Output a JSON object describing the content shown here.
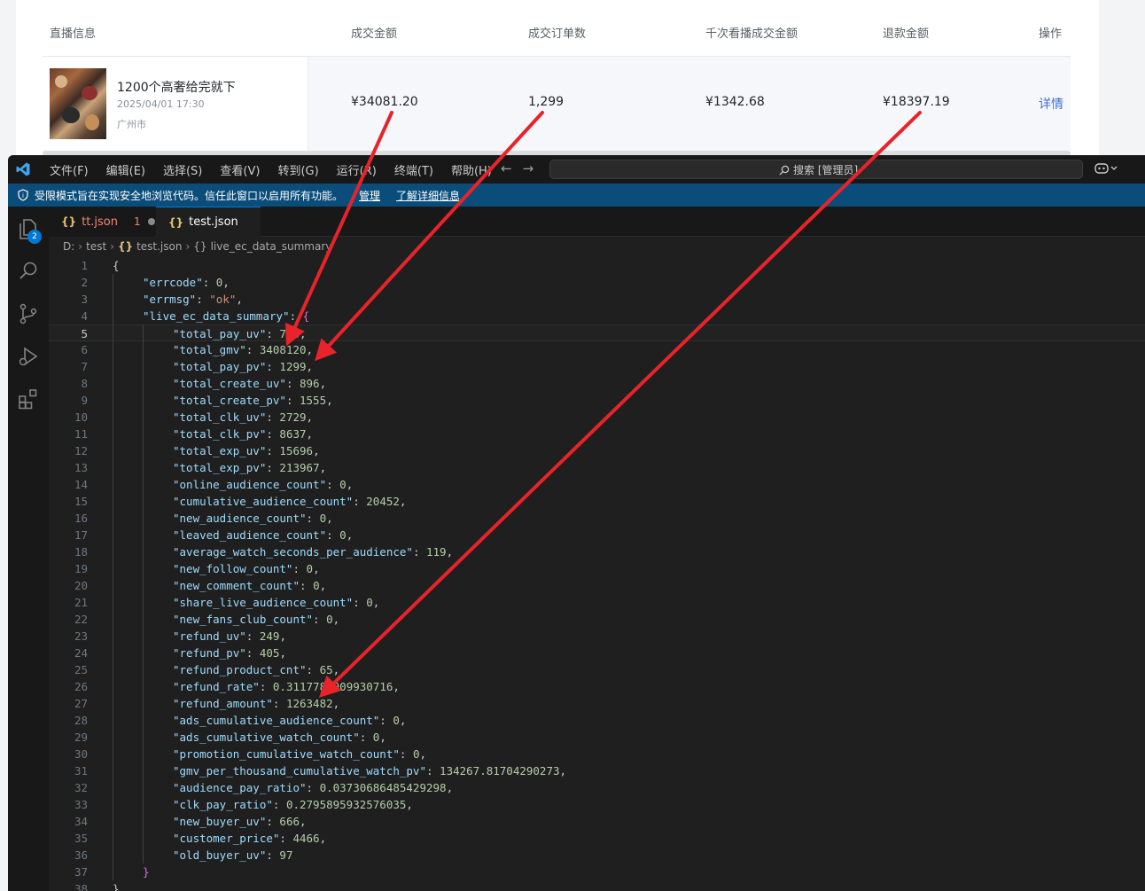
{
  "web_table": {
    "headers": [
      "直播信息",
      "成交金额",
      "成交订单数",
      "千次看播成交金额",
      "退款金额",
      "操作"
    ],
    "row": {
      "title": "1200个高奢给完就下",
      "time": "2025/04/01 17:30",
      "city": "广州市",
      "gmv": "¥34081.20",
      "orders": "1,299",
      "gmv_per_thousand": "¥1342.68",
      "refund": "¥18397.19",
      "action": "详情"
    }
  },
  "vscode": {
    "menu": [
      "文件(F)",
      "编辑(E)",
      "选择(S)",
      "查看(V)",
      "转到(G)",
      "运行(R)",
      "终端(T)",
      "帮助(H)"
    ],
    "search_placeholder": "搜索 [管理员]",
    "banner": {
      "text": "受限模式旨在实现安全地浏览代码。信任此窗口以启用所有功能。",
      "manage": "管理",
      "learn_more": "了解详细信息"
    },
    "explorer_badge": "2",
    "tabs": [
      {
        "name": "tt.json",
        "problems": "1",
        "modified": true,
        "active": false
      },
      {
        "name": "test.json",
        "modified": true,
        "active": true
      }
    ],
    "breadcrumb": [
      "D:",
      "test",
      "test.json",
      "live_ec_data_summary"
    ],
    "current_line": 5,
    "code_lines": [
      [
        [
          "p",
          "{"
        ]
      ],
      [
        [
          "k",
          "\"errcode\""
        ],
        [
          "p",
          ": "
        ],
        [
          "n",
          "0"
        ],
        [
          "p",
          ","
        ]
      ],
      [
        [
          "k",
          "\"errmsg\""
        ],
        [
          "p",
          ": "
        ],
        [
          "s",
          "\"ok\""
        ],
        [
          "p",
          ","
        ]
      ],
      [
        [
          "k",
          "\"live_ec_data_summary\""
        ],
        [
          "p",
          ": "
        ],
        [
          "b2",
          "{"
        ]
      ],
      [
        [
          "k",
          "\"total_pay_uv\""
        ],
        [
          "p",
          ": "
        ],
        [
          "n",
          "763"
        ],
        [
          "p",
          ","
        ]
      ],
      [
        [
          "k",
          "\"total_gmv\""
        ],
        [
          "p",
          ": "
        ],
        [
          "n",
          "3408120"
        ],
        [
          "p",
          ","
        ]
      ],
      [
        [
          "k",
          "\"total_pay_pv\""
        ],
        [
          "p",
          ": "
        ],
        [
          "n",
          "1299"
        ],
        [
          "p",
          ","
        ]
      ],
      [
        [
          "k",
          "\"total_create_uv\""
        ],
        [
          "p",
          ": "
        ],
        [
          "n",
          "896"
        ],
        [
          "p",
          ","
        ]
      ],
      [
        [
          "k",
          "\"total_create_pv\""
        ],
        [
          "p",
          ": "
        ],
        [
          "n",
          "1555"
        ],
        [
          "p",
          ","
        ]
      ],
      [
        [
          "k",
          "\"total_clk_uv\""
        ],
        [
          "p",
          ": "
        ],
        [
          "n",
          "2729"
        ],
        [
          "p",
          ","
        ]
      ],
      [
        [
          "k",
          "\"total_clk_pv\""
        ],
        [
          "p",
          ": "
        ],
        [
          "n",
          "8637"
        ],
        [
          "p",
          ","
        ]
      ],
      [
        [
          "k",
          "\"total_exp_uv\""
        ],
        [
          "p",
          ": "
        ],
        [
          "n",
          "15696"
        ],
        [
          "p",
          ","
        ]
      ],
      [
        [
          "k",
          "\"total_exp_pv\""
        ],
        [
          "p",
          ": "
        ],
        [
          "n",
          "213967"
        ],
        [
          "p",
          ","
        ]
      ],
      [
        [
          "k",
          "\"online_audience_count\""
        ],
        [
          "p",
          ": "
        ],
        [
          "n",
          "0"
        ],
        [
          "p",
          ","
        ]
      ],
      [
        [
          "k",
          "\"cumulative_audience_count\""
        ],
        [
          "p",
          ": "
        ],
        [
          "n",
          "20452"
        ],
        [
          "p",
          ","
        ]
      ],
      [
        [
          "k",
          "\"new_audience_count\""
        ],
        [
          "p",
          ": "
        ],
        [
          "n",
          "0"
        ],
        [
          "p",
          ","
        ]
      ],
      [
        [
          "k",
          "\"leaved_audience_count\""
        ],
        [
          "p",
          ": "
        ],
        [
          "n",
          "0"
        ],
        [
          "p",
          ","
        ]
      ],
      [
        [
          "k",
          "\"average_watch_seconds_per_audience\""
        ],
        [
          "p",
          ": "
        ],
        [
          "n",
          "119"
        ],
        [
          "p",
          ","
        ]
      ],
      [
        [
          "k",
          "\"new_follow_count\""
        ],
        [
          "p",
          ": "
        ],
        [
          "n",
          "0"
        ],
        [
          "p",
          ","
        ]
      ],
      [
        [
          "k",
          "\"new_comment_count\""
        ],
        [
          "p",
          ": "
        ],
        [
          "n",
          "0"
        ],
        [
          "p",
          ","
        ]
      ],
      [
        [
          "k",
          "\"share_live_audience_count\""
        ],
        [
          "p",
          ": "
        ],
        [
          "n",
          "0"
        ],
        [
          "p",
          ","
        ]
      ],
      [
        [
          "k",
          "\"new_fans_club_count\""
        ],
        [
          "p",
          ": "
        ],
        [
          "n",
          "0"
        ],
        [
          "p",
          ","
        ]
      ],
      [
        [
          "k",
          "\"refund_uv\""
        ],
        [
          "p",
          ": "
        ],
        [
          "n",
          "249"
        ],
        [
          "p",
          ","
        ]
      ],
      [
        [
          "k",
          "\"refund_pv\""
        ],
        [
          "p",
          ": "
        ],
        [
          "n",
          "405"
        ],
        [
          "p",
          ","
        ]
      ],
      [
        [
          "k",
          "\"refund_product_cnt\""
        ],
        [
          "p",
          ": "
        ],
        [
          "n",
          "65"
        ],
        [
          "p",
          ","
        ]
      ],
      [
        [
          "k",
          "\"refund_rate\""
        ],
        [
          "p",
          ": "
        ],
        [
          "n",
          "0.3117782909930716"
        ],
        [
          "p",
          ","
        ]
      ],
      [
        [
          "k",
          "\"refund_amount\""
        ],
        [
          "p",
          ": "
        ],
        [
          "n",
          "1263482"
        ],
        [
          "p",
          ","
        ]
      ],
      [
        [
          "k",
          "\"ads_cumulative_audience_count\""
        ],
        [
          "p",
          ": "
        ],
        [
          "n",
          "0"
        ],
        [
          "p",
          ","
        ]
      ],
      [
        [
          "k",
          "\"ads_cumulative_watch_count\""
        ],
        [
          "p",
          ": "
        ],
        [
          "n",
          "0"
        ],
        [
          "p",
          ","
        ]
      ],
      [
        [
          "k",
          "\"promotion_cumulative_watch_count\""
        ],
        [
          "p",
          ": "
        ],
        [
          "n",
          "0"
        ],
        [
          "p",
          ","
        ]
      ],
      [
        [
          "k",
          "\"gmv_per_thousand_cumulative_watch_pv\""
        ],
        [
          "p",
          ": "
        ],
        [
          "n",
          "134267.81704290273"
        ],
        [
          "p",
          ","
        ]
      ],
      [
        [
          "k",
          "\"audience_pay_ratio\""
        ],
        [
          "p",
          ": "
        ],
        [
          "n",
          "0.03730686485429298"
        ],
        [
          "p",
          ","
        ]
      ],
      [
        [
          "k",
          "\"clk_pay_ratio\""
        ],
        [
          "p",
          ": "
        ],
        [
          "n",
          "0.2795895932576035"
        ],
        [
          "p",
          ","
        ]
      ],
      [
        [
          "k",
          "\"new_buyer_uv\""
        ],
        [
          "p",
          ": "
        ],
        [
          "n",
          "666"
        ],
        [
          "p",
          ","
        ]
      ],
      [
        [
          "k",
          "\"customer_price\""
        ],
        [
          "p",
          ": "
        ],
        [
          "n",
          "4466"
        ],
        [
          "p",
          ","
        ]
      ],
      [
        [
          "k",
          "\"old_buyer_uv\""
        ],
        [
          "p",
          ": "
        ],
        [
          "n",
          "97"
        ]
      ],
      [
        [
          "b2",
          "}"
        ]
      ],
      [
        [
          "p",
          "}"
        ]
      ]
    ],
    "indent_levels": [
      0,
      1,
      1,
      1,
      2,
      2,
      2,
      2,
      2,
      2,
      2,
      2,
      2,
      2,
      2,
      2,
      2,
      2,
      2,
      2,
      2,
      2,
      2,
      2,
      2,
      2,
      2,
      2,
      2,
      2,
      2,
      2,
      2,
      2,
      2,
      2,
      1,
      0
    ]
  },
  "annotation": {
    "arrow_color": "#e8232a"
  }
}
